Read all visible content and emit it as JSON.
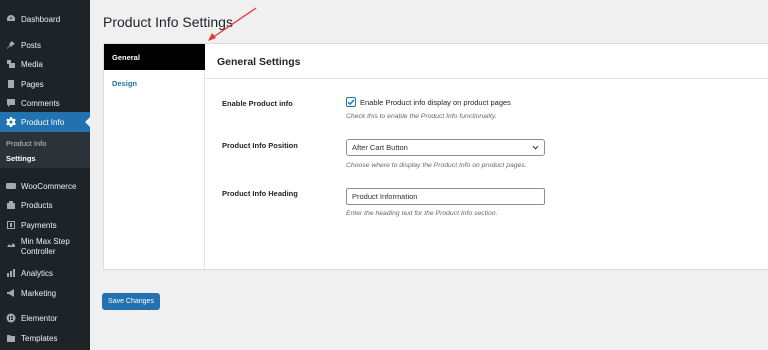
{
  "sidebar": {
    "items": [
      {
        "label": "Dashboard",
        "icon": "dashboard-icon"
      },
      {
        "label": "Posts",
        "icon": "pin-icon"
      },
      {
        "label": "Media",
        "icon": "media-icon"
      },
      {
        "label": "Pages",
        "icon": "pages-icon"
      },
      {
        "label": "Comments",
        "icon": "comments-icon"
      },
      {
        "label": "Product Info",
        "icon": "gear-icon"
      },
      {
        "label": "WooCommerce",
        "icon": "woocommerce-icon"
      },
      {
        "label": "Products",
        "icon": "products-icon"
      },
      {
        "label": "Payments",
        "icon": "payments-icon"
      },
      {
        "label": "Min Max Step Controller",
        "icon": "controller-icon"
      },
      {
        "label": "Analytics",
        "icon": "analytics-icon"
      },
      {
        "label": "Marketing",
        "icon": "megaphone-icon"
      },
      {
        "label": "Elementor",
        "icon": "elementor-icon"
      },
      {
        "label": "Templates",
        "icon": "templates-icon"
      }
    ],
    "submenu": [
      {
        "label": "Product Info"
      },
      {
        "label": "Settings"
      }
    ]
  },
  "page": {
    "title": "Product Info Settings"
  },
  "tabs": [
    {
      "label": "General"
    },
    {
      "label": "Design"
    }
  ],
  "content": {
    "title": "General Settings",
    "enable": {
      "label": "Enable Product info",
      "checkbox_label": "Enable Product info display on product pages",
      "checked": true,
      "description": "Check this to enable the Product Info functionality."
    },
    "position": {
      "label": "Product Info Position",
      "selected": "After Cart Button",
      "description": "Choose where to display the Product Info on product pages."
    },
    "heading": {
      "label": "Product Info Heading",
      "value": "Product Information",
      "description": "Enter the heading text for the Product Info section."
    }
  },
  "actions": {
    "save_label": "Save Changes"
  },
  "colors": {
    "sidebar_bg": "#1d2327",
    "accent": "#2271b1",
    "annotation_arrow": "#e53935"
  }
}
